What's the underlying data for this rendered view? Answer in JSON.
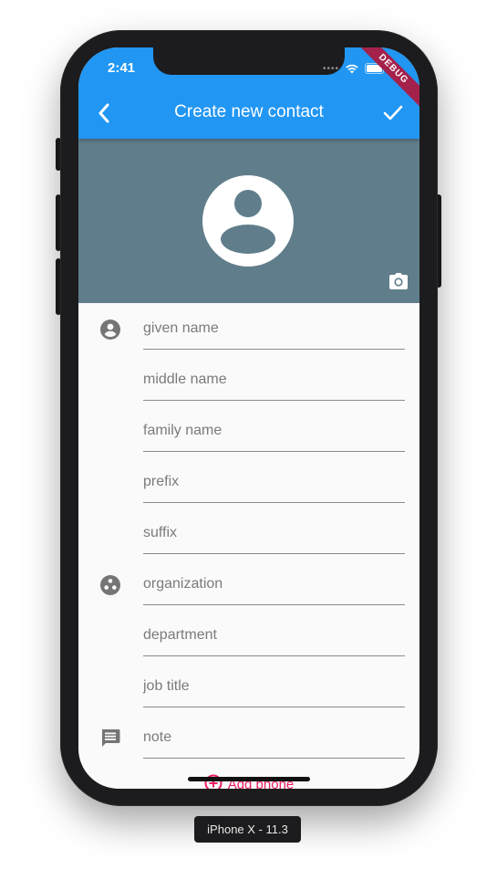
{
  "status_bar": {
    "time": "2:41"
  },
  "debug_banner": "DEBUG",
  "app_bar": {
    "title": "Create new contact"
  },
  "fields": {
    "given_name": "given name",
    "middle_name": "middle name",
    "family_name": "family name",
    "prefix": "prefix",
    "suffix": "suffix",
    "organization": "organization",
    "department": "department",
    "job_title": "job title",
    "note": "note"
  },
  "add_phone_label": "Add phone",
  "device_label": "iPhone X - 11.3",
  "colors": {
    "app_bar": "#2196f3",
    "avatar_background": "#607d8b",
    "accent": "#e91e63"
  },
  "icons": {
    "back": "chevron-left-icon",
    "done": "check-icon",
    "camera": "camera-icon",
    "person": "account-circle-icon",
    "organization": "group-work-icon",
    "note": "comment-icon"
  }
}
